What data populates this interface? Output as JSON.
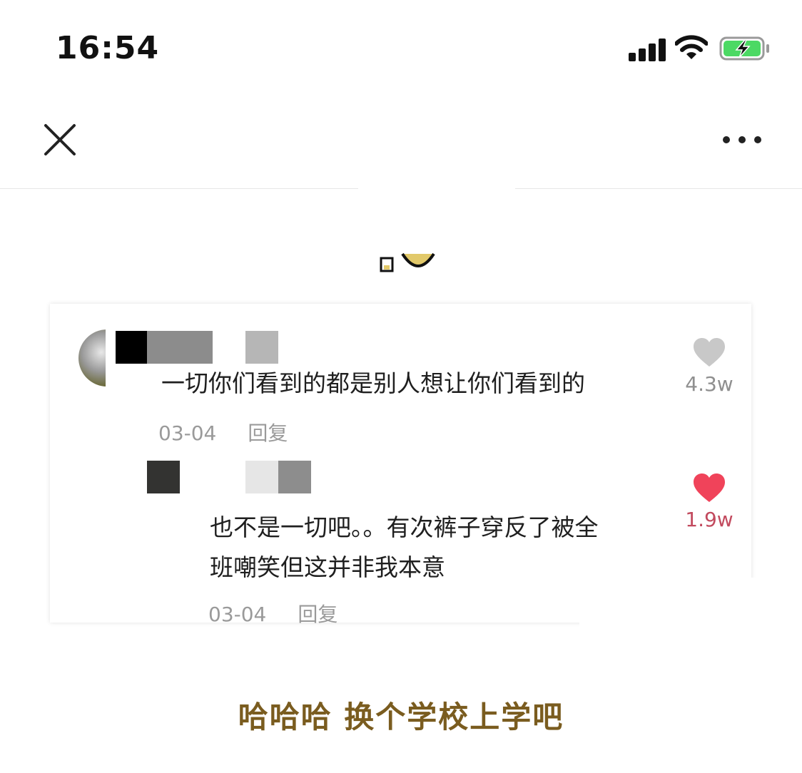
{
  "status_bar": {
    "time": "16:54",
    "signal_icon": "cellular-signal-icon",
    "wifi_icon": "wifi-icon",
    "battery_icon": "battery-charging-icon",
    "battery_color": "#4cd964"
  },
  "nav": {
    "close_icon": "close-icon",
    "more_icon": "more-dots-icon"
  },
  "comments": [
    {
      "text": "一切你们看到的都是别人想让你们看到的",
      "date": "03-04",
      "reply_label": "回复",
      "likes": "4.3w",
      "liked": false
    },
    {
      "text_line1": "也不是一切吧。。有次裤子穿反了被全",
      "text_line2": "班嘲笑但这并非我本意",
      "date": "03-04",
      "reply_label": "回复",
      "likes": "1.9w",
      "liked": true
    }
  ],
  "caption": "哈哈哈 换个学校上学吧",
  "colors": {
    "like_active": "#f0435a",
    "like_inactive": "#c8c8c8",
    "caption": "#7a5c1f"
  }
}
